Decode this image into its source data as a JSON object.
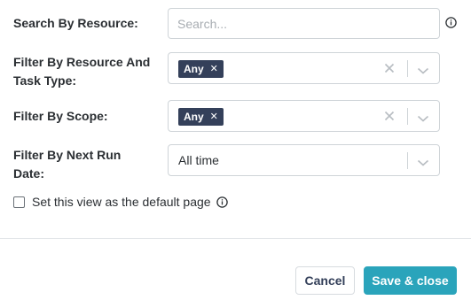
{
  "filters": {
    "search_label": "Search By Resource:",
    "search_placeholder": "Search...",
    "resource_label_line1": "Filter By Resource And",
    "resource_label_line2": "Task Type:",
    "resource_chip": "Any",
    "scope_label": "Filter By Scope:",
    "scope_chip": "Any",
    "next_run_label_line1": "Filter By Next Run",
    "next_run_label_line2": "Date:",
    "next_run_value": "All time"
  },
  "default_view": {
    "label": "Set this view as the default page",
    "checked": false
  },
  "footer": {
    "cancel_label": "Cancel",
    "save_label": "Save & close"
  },
  "colors": {
    "accent": "#2aa4bb",
    "chip_bg": "#34405a"
  }
}
